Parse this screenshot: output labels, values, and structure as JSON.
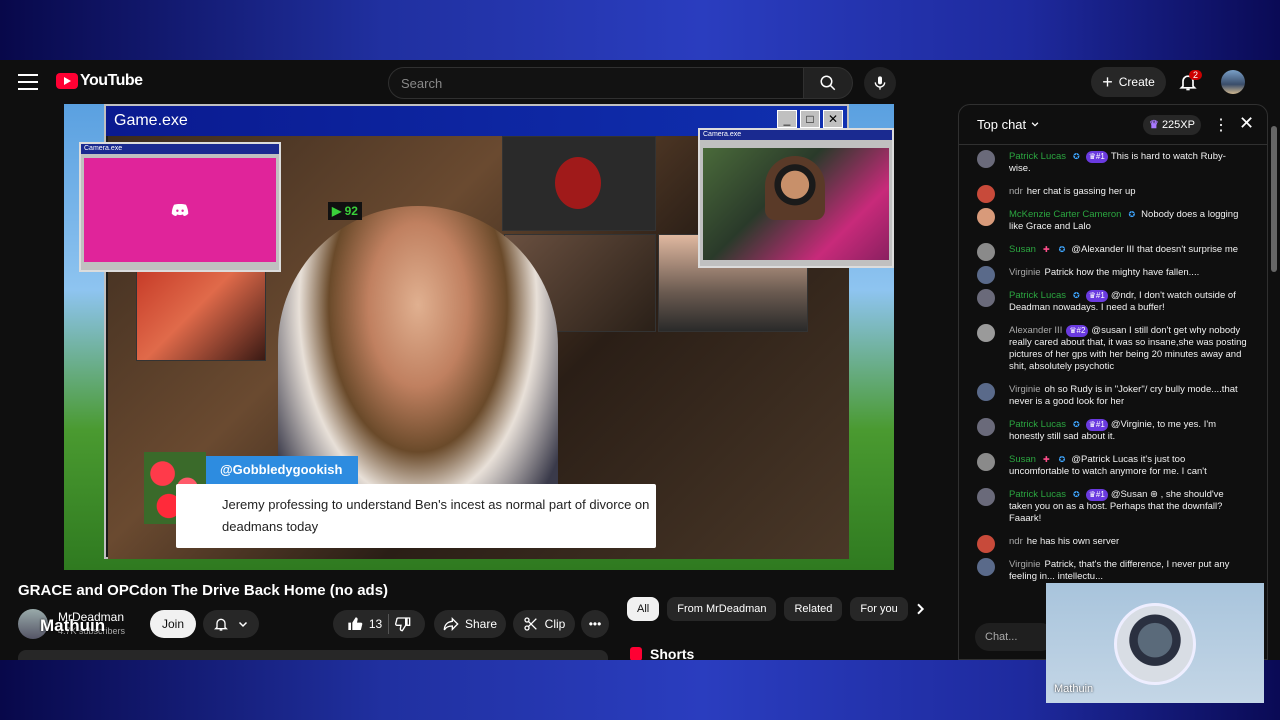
{
  "header": {
    "logo_text": "YouTube",
    "search_placeholder": "Search",
    "create_label": "Create",
    "notification_count": "2"
  },
  "video": {
    "window_title": "Game.exe",
    "camera_title": "Camera.exe",
    "viewer_badge": "92",
    "quote_username": "@Gobbledygookish",
    "quote_text": "Jeremy professing to understand Ben's incest as normal part of divorce on deadmans today"
  },
  "below": {
    "title": "GRACE and OPCdon The Drive Back Home (no ads)",
    "channel_name": "MrDeadman",
    "channel_subs": "4.7K subscribers",
    "overlay_name": "Mathuin",
    "join_label": "Join",
    "like_count": "13",
    "share_label": "Share",
    "clip_label": "Clip",
    "chips": [
      "All",
      "From MrDeadman",
      "Related",
      "For you"
    ],
    "shorts_label": "Shorts"
  },
  "chat": {
    "mode_label": "Top chat",
    "xp_label": "225XP",
    "input_placeholder": "Chat...",
    "messages": [
      {
        "author": "Patrick Lucas",
        "mod": true,
        "star": true,
        "rank": "#1",
        "text": "This is hard to watch Ruby-wise.",
        "color": "#6a6a7a"
      },
      {
        "author": "ndr",
        "mod": false,
        "text": "her chat is gassing her up",
        "color": "#c84a3a"
      },
      {
        "author": "McKenzie Carter Cameron",
        "mod": true,
        "star": true,
        "text": "Nobody does a logging like Grace and Lalo",
        "color": "#d89a7a"
      },
      {
        "author": "Susan",
        "mod": true,
        "heart": true,
        "star": true,
        "text": "@Alexander III that doesn't surprise me",
        "color": "#8a8a8a"
      },
      {
        "author": "Virginie",
        "mod": false,
        "text": "Patrick how the mighty have fallen....",
        "color": "#5a6a8a"
      },
      {
        "author": "Patrick Lucas",
        "mod": true,
        "star": true,
        "rank": "#1",
        "text": "@ndr, I don't watch outside of Deadman nowadays. I need a buffer!",
        "color": "#6a6a7a"
      },
      {
        "author": "Alexander III",
        "mod": false,
        "rank": "#2",
        "text": "@susan I still don't get why nobody really cared about that, it was so insane,she was posting pictures of her gps with her being 20 minutes away and shit, absolutely psychotic",
        "color": "#9a9a9a"
      },
      {
        "author": "Virginie",
        "mod": false,
        "text": "oh so Rudy is in \"Joker\"/ cry bully mode....that never is a good look for her",
        "color": "#5a6a8a"
      },
      {
        "author": "Patrick Lucas",
        "mod": true,
        "star": true,
        "rank": "#1",
        "text": "@Virginie, to me yes. I'm honestly still sad about it.",
        "color": "#6a6a7a"
      },
      {
        "author": "Susan",
        "mod": true,
        "heart": true,
        "star": true,
        "text": "@Patrick Lucas it's just too uncomfortable to watch anymore for me. I can't",
        "color": "#8a8a8a"
      },
      {
        "author": "Patrick Lucas",
        "mod": true,
        "star": true,
        "rank": "#1",
        "text": "@Susan ⊛ , she should've taken you on as a host. Perhaps that the downfall? Faaark!",
        "color": "#6a6a7a"
      },
      {
        "author": "ndr",
        "mod": false,
        "text": "he has his own server",
        "color": "#c84a3a"
      },
      {
        "author": "Virginie",
        "mod": false,
        "text": "Patrick, that's the difference, I never put any feeling in... intellectu...",
        "color": "#5a6a8a"
      }
    ]
  },
  "webcam": {
    "label": "Mathuin"
  }
}
